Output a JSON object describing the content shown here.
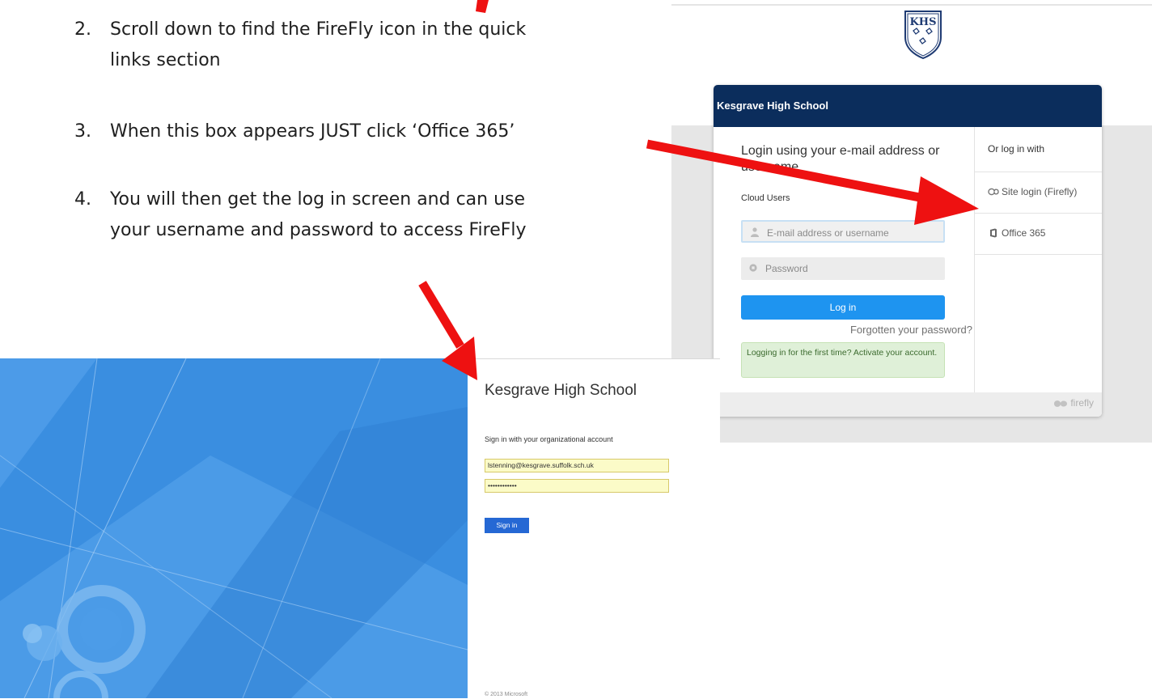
{
  "instructions": {
    "steps": [
      {
        "number": "2.",
        "line1": "Scroll down to find the FireFly icon in the quick",
        "line2": "links section"
      },
      {
        "number": "3.",
        "line1": "When this box appears JUST click ‘Office 365’",
        "line2": ""
      },
      {
        "number": "4.",
        "line1": "You will then get the log in screen and can use",
        "line2": "your username and password to access FireFly"
      }
    ]
  },
  "firefly_login": {
    "crest_text": "KHS",
    "header_title": "Kesgrave High School",
    "form_title": "Login using your e-mail address or username",
    "section_label": "Cloud Users",
    "email_placeholder": "E-mail address or username",
    "password_placeholder": "Password",
    "login_button": "Log in",
    "forgot_link": "Forgotten your password?",
    "first_time_text": "Logging in for the first time? Activate your account.",
    "alt_login_heading": "Or log in with",
    "alt_options": [
      {
        "label": "Site login (Firefly)",
        "icon": "firefly-icon"
      },
      {
        "label": "Office 365",
        "icon": "office-icon"
      }
    ],
    "brand_label": "firefly"
  },
  "office365_signin": {
    "org_title": "Kesgrave High School",
    "prompt": "Sign in with your organizational account",
    "username_value": "lstenning@kesgrave.suffolk.sch.uk",
    "password_value": "••••••••••••",
    "signin_button": "Sign in",
    "copyright": "© 2013 Microsoft"
  },
  "colors": {
    "arrow_red": "#ee1111",
    "firefly_header": "#0b2d5c",
    "login_button": "#1e94f0",
    "ms_background": "#3a8ee0",
    "ms_button": "#2568d4"
  }
}
